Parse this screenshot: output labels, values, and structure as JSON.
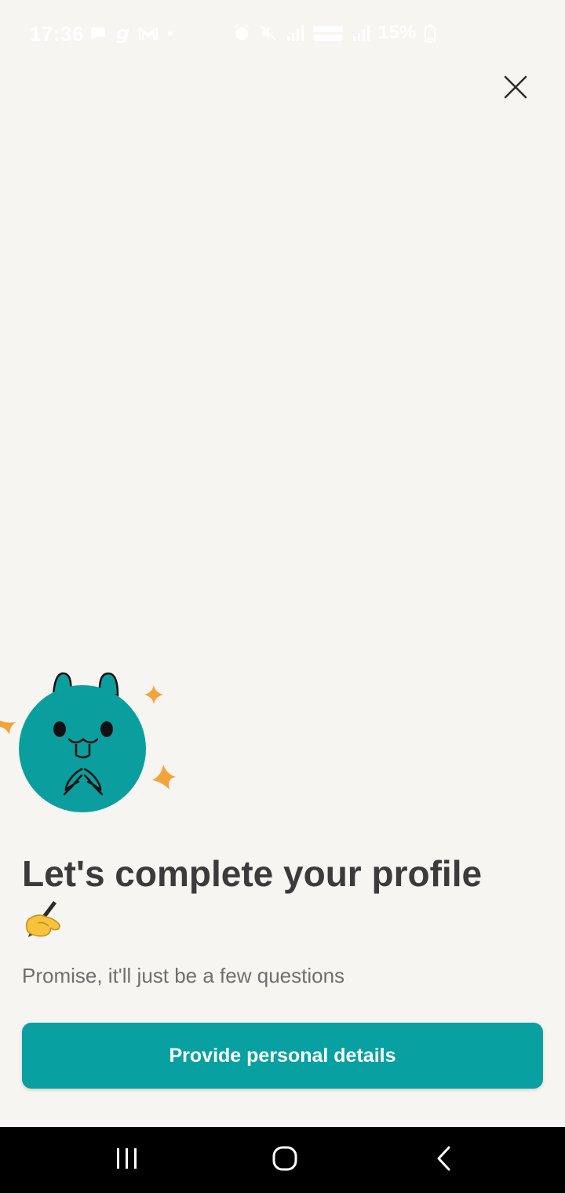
{
  "status_bar": {
    "time": "17:36",
    "battery": "15%",
    "icons": [
      "message-icon",
      "g-app-icon",
      "gmail-icon",
      "dot-icon",
      "alarm-icon",
      "mute-icon",
      "signal-icon",
      "volte-lte-icon",
      "signal-icon-2",
      "battery-icon"
    ]
  },
  "close_icon": "close-icon",
  "mascot": {
    "body_color": "#0b9e9e",
    "sparkle_color": "#f2a33a"
  },
  "content": {
    "title": "Let's complete your profile",
    "title_emoji": "✍️",
    "subtitle": "Promise, it'll just be a few questions"
  },
  "primary_button": {
    "label": "Provide personal details",
    "color": "#08a0a0"
  },
  "nav_bar": {
    "recents_icon": "recents-icon",
    "home_icon": "home-icon",
    "back_icon": "back-icon"
  }
}
